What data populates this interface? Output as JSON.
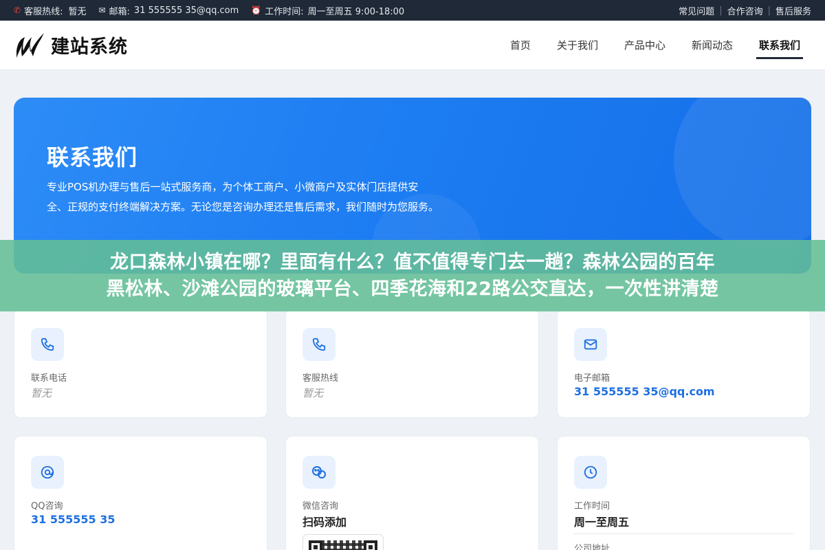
{
  "topbar": {
    "hotline_label": "客服热线:",
    "hotline_value": "暂无",
    "email_label": "邮箱:",
    "email_value": "31 555555 35@qq.com",
    "hours_label": "工作时间:",
    "hours_value": "周一至周五 9:00-18:00",
    "links": [
      "常见问题",
      "合作咨询",
      "售后服务"
    ]
  },
  "header": {
    "logo_text": "建站系统",
    "nav": [
      "首页",
      "关于我们",
      "产品中心",
      "新闻动态",
      "联系我们"
    ],
    "active_nav": "联系我们"
  },
  "hero": {
    "title": "联系我们",
    "description": "专业POS机办理与售后一站式服务商，为个体工商户、小微商户及实体门店提供安全、正规的支付终端解决方案。无论您是咨询办理还是售后需求，我们随时为您服务。"
  },
  "banner": {
    "line1": "龙口森林小镇在哪？里面有什么？值不值得专门去一趟？森林公园的百年",
    "line2": "黑松林、沙滩公园的玻璃平台、四季花海和22路公交直达，一次性讲清楚"
  },
  "cards": {
    "phone": {
      "label": "联系电话",
      "value": "暂无"
    },
    "service": {
      "label": "客服热线",
      "value": "暂无"
    },
    "email": {
      "label": "电子邮箱",
      "value": "31 555555 35@qq.com"
    },
    "qq": {
      "label": "QQ咨询",
      "value": "31 555555 35"
    },
    "wechat": {
      "label": "微信咨询",
      "value": "扫码添加"
    },
    "hours": {
      "label": "工作时间",
      "value": "周一至周五",
      "next_label": "公司地址"
    }
  },
  "colors": {
    "accent": "#1d6fe0",
    "hero_start": "#2d8cf6",
    "hero_end": "#156fe8",
    "banner": "#64be96",
    "topbar": "#1f2937"
  }
}
